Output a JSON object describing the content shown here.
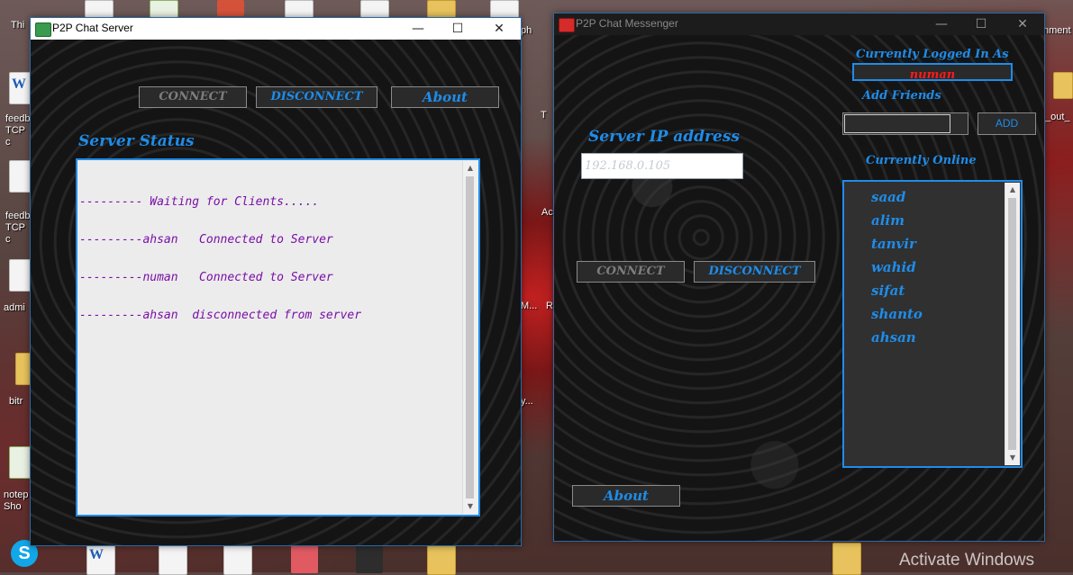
{
  "desktop": {
    "icons": [
      {
        "id": "thispc",
        "label": "Thi"
      },
      {
        "id": "feedback1",
        "label": "feedb TCP c"
      },
      {
        "id": "feedback2",
        "label": "feedb TCP c"
      },
      {
        "id": "admin",
        "label": "admi"
      },
      {
        "id": "bitr",
        "label": "bitr"
      },
      {
        "id": "notepad",
        "label": "notep Sho"
      },
      {
        "id": "right-ph",
        "label": "ph"
      },
      {
        "id": "right-ment",
        "label": "nment"
      },
      {
        "id": "right-out",
        "label": "_out_"
      },
      {
        "id": "mid-t",
        "label": "T"
      },
      {
        "id": "mid-ac",
        "label": "Ac"
      },
      {
        "id": "mid-m",
        "label": "M..."
      },
      {
        "id": "mid-r",
        "label": "R"
      },
      {
        "id": "mid-y",
        "label": "y..."
      }
    ],
    "watermark": "Activate Windows"
  },
  "server_window": {
    "title": "P2P Chat Server",
    "controls": {
      "minimize": "—",
      "maximize": "☐",
      "close": "✕"
    },
    "buttons": {
      "connect": "CONNECT",
      "disconnect": "DISCONNECT",
      "about": "About"
    },
    "status_label": "Server Status",
    "log_lines": [
      "--------- Waiting for Clients.....",
      "---------ahsan   Connected to Server",
      "---------numan   Connected to Server",
      "---------ahsan  disconnected from server"
    ]
  },
  "messenger_window": {
    "title": "P2P Chat Messenger",
    "controls": {
      "minimize": "—",
      "maximize": "☐",
      "close": "✕"
    },
    "logged_in_label": "Currently Logged In As",
    "logged_in_user": "numan",
    "add_friends_label": "Add Friends",
    "add_friend_input_value": "",
    "add_button": "ADD",
    "server_ip_label": "Server IP address",
    "server_ip_placeholder": "192.168.0.105",
    "buttons": {
      "connect": "CONNECT",
      "disconnect": "DISCONNECT",
      "about": "About"
    },
    "online_label": "Currently Online",
    "online_users": [
      "saad",
      "alim",
      "tanvir",
      "wahid",
      "sifat",
      "shanto",
      "ahsan"
    ]
  },
  "colors": {
    "accent_blue": "#1f8ce8",
    "log_text": "#7a0ea8",
    "username_red": "#ff1a1a",
    "disabled_text": "#7d7d7d"
  }
}
